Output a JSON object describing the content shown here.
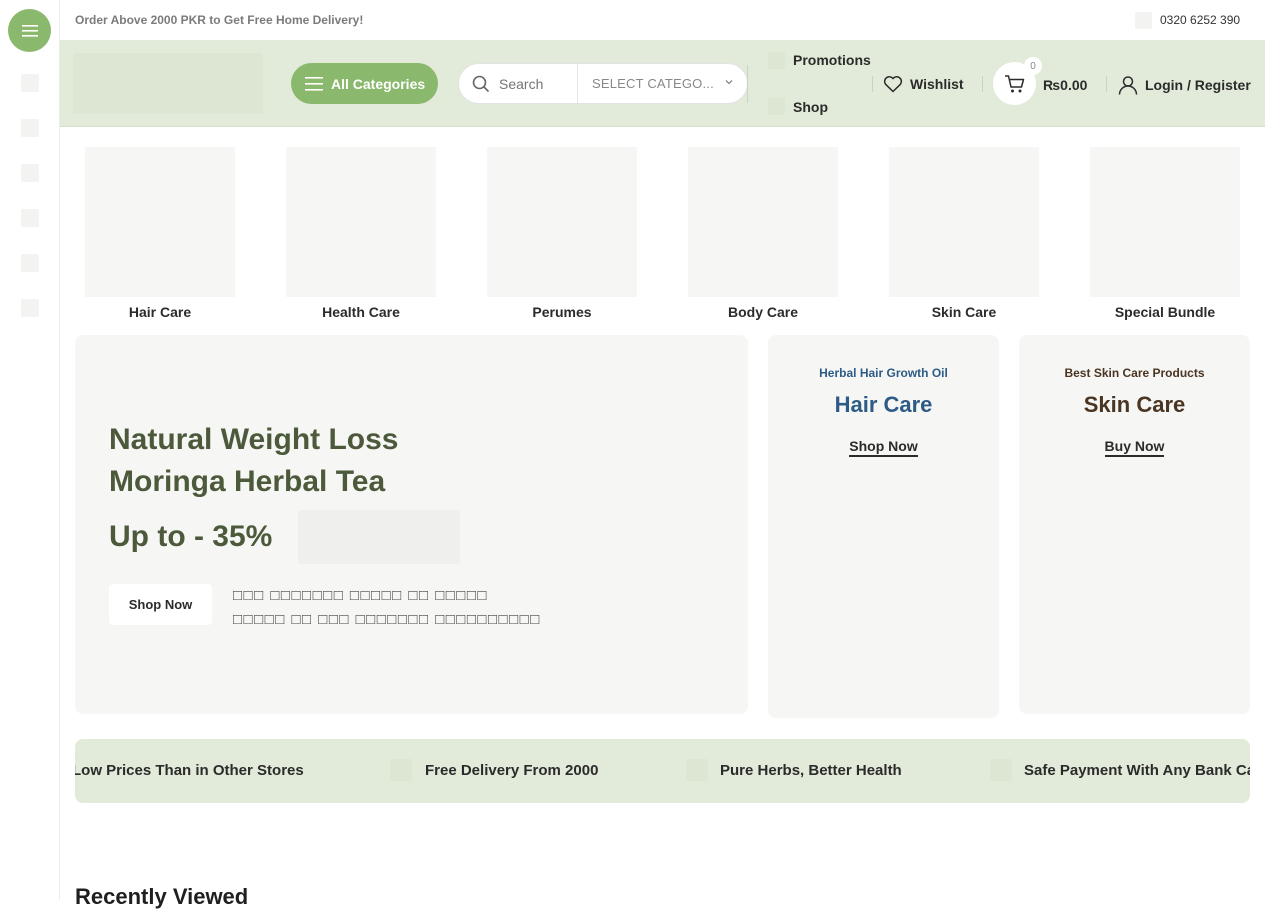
{
  "topbar": {
    "promo": "Order Above 2000 PKR to Get Free Home Delivery!",
    "phone": "0320 6252 390"
  },
  "header": {
    "all_categories": "All Categories",
    "search_placeholder": "Search",
    "category_select": "SELECT CATEGO...",
    "promotions": "Promotions",
    "shop": "Shop",
    "wishlist": "Wishlist",
    "cart_count": "0",
    "cart_total": "₨0.00",
    "login": "Login / Register"
  },
  "categories": [
    {
      "label": "Hair Care"
    },
    {
      "label": "Health Care"
    },
    {
      "label": "Perumes"
    },
    {
      "label": "Body Care"
    },
    {
      "label": "Skin Care"
    },
    {
      "label": "Special Bundle"
    }
  ],
  "hero": {
    "title": "Natural Weight Loss Moringa Herbal Tea",
    "discount": "Up to - 35%",
    "button": "Shop Now",
    "urdu_line1": "□□□ □□□□□□□ □□□□□ □□ □□□□□",
    "urdu_line2": "□□□□□ □□ □□□ □□□□□□□ □□□□□□□□□□"
  },
  "banners": [
    {
      "subtitle": "Herbal Hair Growth Oil",
      "title": "Hair Care",
      "link": "Shop Now",
      "color": "#2d5b86"
    },
    {
      "subtitle": "Best Skin Care Products",
      "title": "Skin Care",
      "link": "Buy Now",
      "color": "#4a3422"
    }
  ],
  "strip": [
    {
      "text": "Low Prices Than in Other Stores"
    },
    {
      "text": "Free Delivery From 2000"
    },
    {
      "text": "Pure Herbs, Better Health"
    },
    {
      "text": "Safe Payment With Any Bank Card"
    }
  ],
  "section": {
    "recently_viewed": "Recently Viewed"
  },
  "colors": {
    "brand_green": "#8ab86c",
    "header_bg": "#e2ebd9",
    "hero_text": "#4c5a3b"
  }
}
